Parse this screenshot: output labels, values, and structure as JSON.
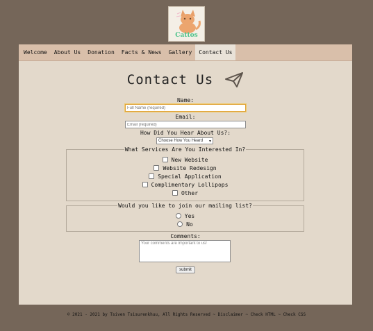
{
  "logo": {
    "text": "Cattos"
  },
  "nav": {
    "items": [
      {
        "label": "Welcome"
      },
      {
        "label": "About Us"
      },
      {
        "label": "Donation"
      },
      {
        "label": "Facts & News"
      },
      {
        "label": "Gallery"
      },
      {
        "label": "Contact Us",
        "active": true
      }
    ]
  },
  "page": {
    "title": "Contact Us"
  },
  "form": {
    "name_label": "Name:",
    "name_placeholder": "Full Name (required)",
    "email_label": "Email:",
    "email_placeholder": "Email (required)",
    "hear_label": "How Did You Hear About Us?:",
    "hear_selected": "Choose How You Heard",
    "services_legend": "What Services Are You Interested In?",
    "services": [
      "New Website",
      "Website Redesign",
      "Special Application",
      "Complimentary Lollipops",
      "Other"
    ],
    "mailing_legend": "Would you like to join our mailing list?",
    "mailing_options": [
      "Yes",
      "No"
    ],
    "comments_label": "Comments:",
    "comments_placeholder": "Your comments are important to us!",
    "submit_label": "submit"
  },
  "footer": {
    "text": "© 2021 - 2021 by Tsiven Tsisurenkhuu, All Rights Reserved ~ Disclaimer ~ Check HTML ~ Check CSS"
  },
  "colors": {
    "background": "#756659",
    "container": "#e3d9cb",
    "nav": "#d9bfaa",
    "nav_active": "#e9e2d8",
    "focus": "#e0a43a"
  }
}
